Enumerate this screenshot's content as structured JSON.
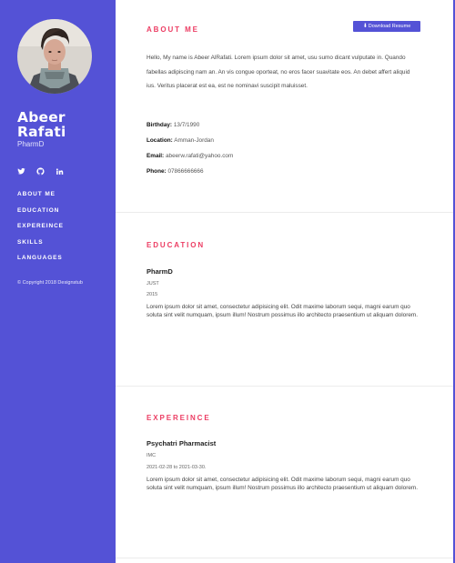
{
  "sidebar": {
    "name_line1": "Abeer",
    "name_line2": "Rafati",
    "role": "PharmD",
    "socials": [
      "twitter-icon",
      "github-icon",
      "linkedin-icon"
    ],
    "nav": [
      "ABOUT ME",
      "EDUCATION",
      "EXPEREINCE",
      "SKILLS",
      "LANGUAGES"
    ],
    "copyright": "© Copyright 2018 Designstub",
    "color": "#5452d6"
  },
  "about": {
    "title": "ABOUT ME",
    "download_label": "Download Resume",
    "download_icon": "download-icon",
    "bio": "Hello, My name is Abeer AlRafati. Lorem ipsum dolor sit amet, usu sumo dicant vulputate in. Quando fabellas adipiscing nam an. An vis congue oporteat, no eros facer suavitate eos. An debet affert aliquid ius. Veritus placerat est ea, est ne nominavi suscipit maluisset.",
    "birthday_label": "Birthday:",
    "birthday": "13/7/1990",
    "location_label": "Location:",
    "location": "Amman-Jordan",
    "email_label": "Email:",
    "email": "abeerw.rafati@yahoo.com",
    "phone_label": "Phone:",
    "phone": "07866666666"
  },
  "education": {
    "title": "EDUCATION",
    "degree": "PharmD",
    "school": "JUST",
    "year": "2015",
    "description": "Lorem ipsum dolor sit amet, consectetur adipisicing elit. Odit maxime laborum sequi, magni earum quo soluta sint velit numquam, ipsum illum! Nostrum possimus illo architecto praesentium ut aliquam dolorem."
  },
  "experience": {
    "title": "EXPEREINCE",
    "job_title": "Psychatri Pharmacist",
    "company": "IMC",
    "dates": "2021-02-28 to 2021-03-30.",
    "description": "Lorem ipsum dolor sit amet, consectetur adipisicing elit. Odit maxime laborum sequi, magni earum quo soluta sint velit numquam, ipsum illum! Nostrum possimus illo architecto praesentium ut aliquam dolorem."
  },
  "colors": {
    "accent": "#5452d6",
    "section_title": "#ec3d63"
  }
}
